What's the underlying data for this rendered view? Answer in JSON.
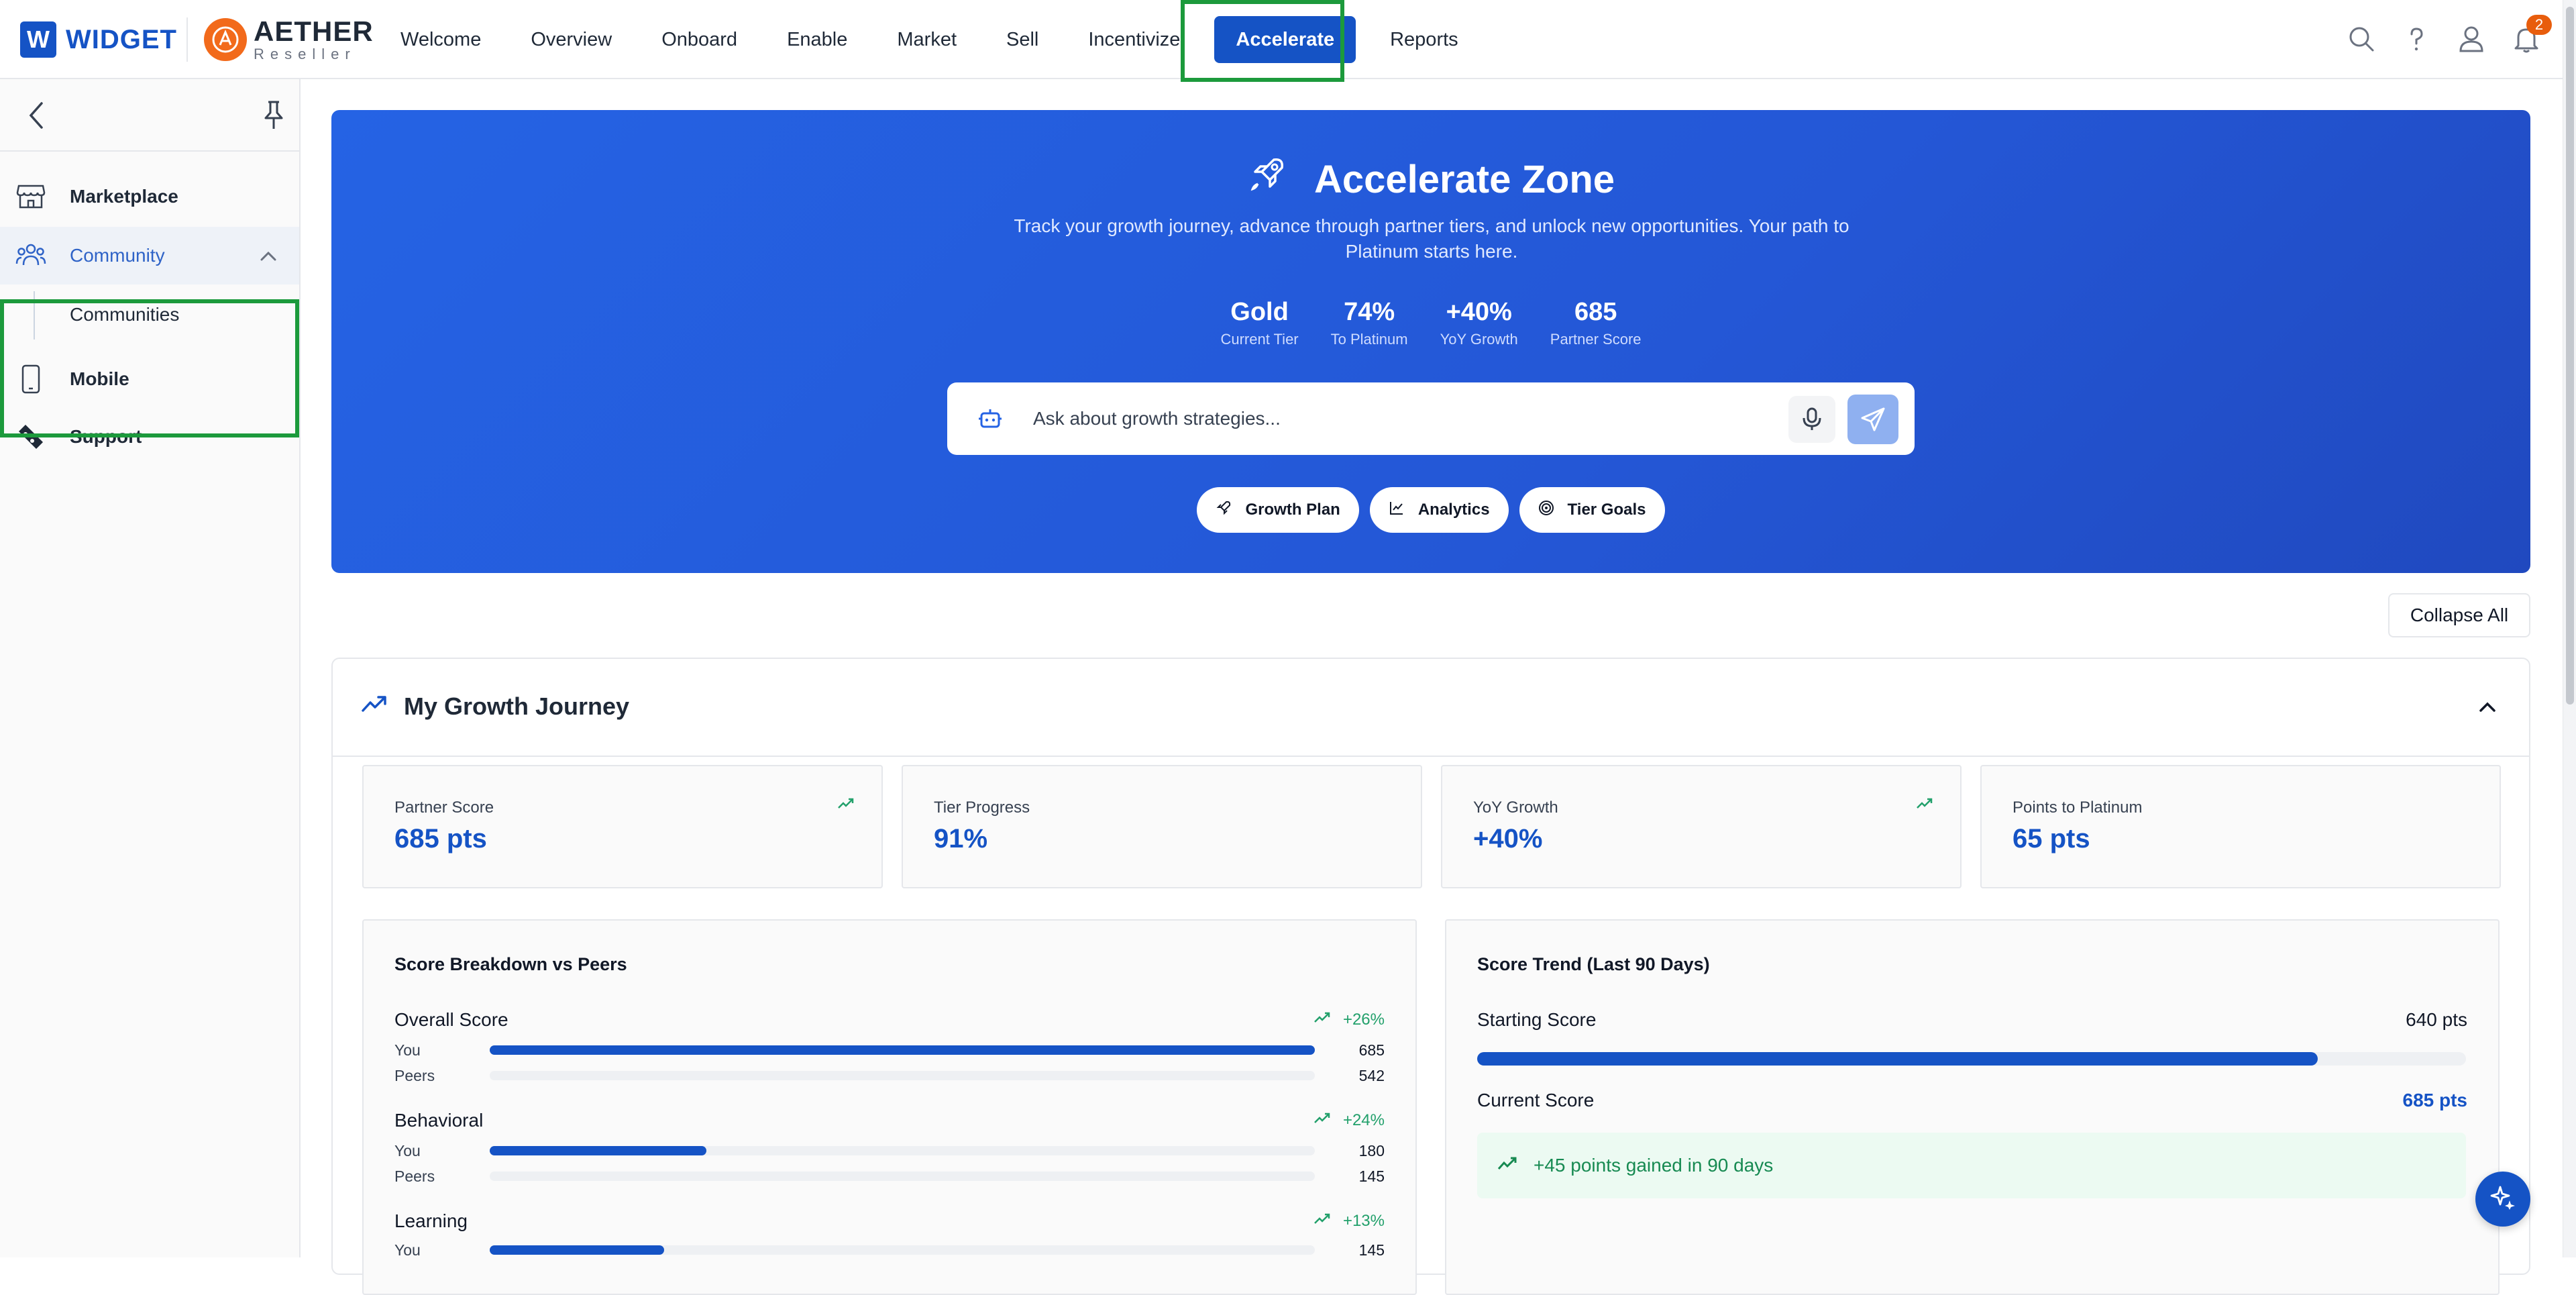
{
  "brand": {
    "widget_letter": "W",
    "widget_name": "WIDGET",
    "partner_name": "AETHER",
    "partner_sub": "Reseller"
  },
  "nav": [
    "Welcome",
    "Overview",
    "Onboard",
    "Enable",
    "Market",
    "Sell",
    "Incentivize",
    "Accelerate",
    "Reports"
  ],
  "nav_active": "Accelerate",
  "notifications_count": "2",
  "sidebar": {
    "items": [
      {
        "label": "Marketplace",
        "icon": "storefront-icon"
      },
      {
        "label": "Community",
        "icon": "community-icon",
        "expanded": true
      },
      {
        "label": "Communities",
        "sub": true
      },
      {
        "label": "Mobile",
        "icon": "mobile-icon"
      },
      {
        "label": "Support",
        "icon": "ticket-icon"
      }
    ]
  },
  "hero": {
    "title": "Accelerate Zone",
    "subtitle": "Track your growth journey, advance through partner tiers, and unlock new opportunities. Your path to Platinum starts here.",
    "stats": [
      {
        "value": "Gold",
        "label": "Current Tier"
      },
      {
        "value": "74%",
        "label": "To Platinum"
      },
      {
        "value": "+40%",
        "label": "YoY Growth"
      },
      {
        "value": "685",
        "label": "Partner Score"
      }
    ],
    "search_placeholder": "Ask about growth strategies...",
    "chips": [
      "Growth Plan",
      "Analytics",
      "Tier Goals"
    ]
  },
  "collapse_all_label": "Collapse All",
  "growth": {
    "title": "My Growth Journey",
    "kpis": [
      {
        "label": "Partner Score",
        "value": "685 pts",
        "trend": true
      },
      {
        "label": "Tier Progress",
        "value": "91%",
        "trend": false
      },
      {
        "label": "YoY Growth",
        "value": "+40%",
        "trend": true
      },
      {
        "label": "Points to Platinum",
        "value": "65 pts",
        "trend": false
      }
    ],
    "breakdown": {
      "title": "Score Breakdown vs Peers",
      "you_label": "You",
      "peers_label": "Peers",
      "scale_max": 685,
      "groups": [
        {
          "name": "Overall Score",
          "delta": "+26%",
          "you": 685,
          "peers": 542
        },
        {
          "name": "Behavioral",
          "delta": "+24%",
          "you": 180,
          "peers": 145
        },
        {
          "name": "Learning",
          "delta": "+13%",
          "you": 145,
          "peers": null
        }
      ]
    },
    "trend": {
      "title": "Score Trend (Last 90 Days)",
      "starting_label": "Starting Score",
      "starting_value": "640 pts",
      "starting_progress": 0.85,
      "current_label": "Current Score",
      "current_value": "685 pts",
      "gain_text": "+45 points gained in 90 days"
    }
  },
  "colors": {
    "primary": "#1553c5",
    "highlight": "#1c9a3c",
    "positive": "#22a06b",
    "badge": "#e85d0c"
  }
}
